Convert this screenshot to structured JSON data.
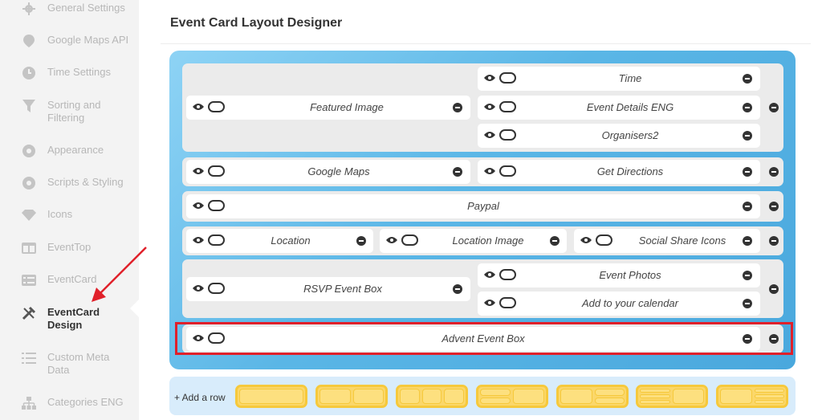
{
  "sidebar": {
    "items": [
      {
        "label": "General Settings",
        "icon": "gear-icon"
      },
      {
        "label": "Google Maps API",
        "icon": "map-pin-icon"
      },
      {
        "label": "Time Settings",
        "icon": "clock-icon"
      },
      {
        "label": "Sorting and Filtering",
        "icon": "filter-icon"
      },
      {
        "label": "Appearance",
        "icon": "eye-icon"
      },
      {
        "label": "Scripts & Styling",
        "icon": "eye-icon"
      },
      {
        "label": "Icons",
        "icon": "diamond-icon"
      },
      {
        "label": "EventTop",
        "icon": "window-icon"
      },
      {
        "label": "EventCard",
        "icon": "list-card-icon"
      },
      {
        "label": "EventCard Design",
        "icon": "tools-icon"
      },
      {
        "label": "Custom Meta Data",
        "icon": "list-icon"
      },
      {
        "label": "Categories ENG",
        "icon": "hierarchy-icon"
      }
    ],
    "active_index": 9
  },
  "main": {
    "title": "Event Card Layout Designer",
    "boxes": {
      "time": "Time",
      "featured_image": "Featured Image",
      "event_details": "Event Details ENG",
      "organisers": "Organisers2",
      "google_maps": "Google Maps",
      "get_directions": "Get Directions",
      "paypal": "Paypal",
      "location": "Location",
      "location_image": "Location Image",
      "social_share": "Social Share Icons",
      "event_photos": "Event Photos",
      "rsvp": "RSVP Event Box",
      "add_calendar": "Add to your calendar",
      "advent": "Advent Event Box"
    },
    "add_row_label": "+ Add a row",
    "layout_options": [
      "1 column",
      "2 columns",
      "3 columns",
      "2 stacked + 1",
      "1 + 2 stacked",
      "3 stacked + 1",
      "1 + 3 stacked"
    ]
  },
  "colors": {
    "accent_red": "#e0202a",
    "designer_blue": "#5ab6e6",
    "layout_yellow": "#fbd76a"
  }
}
